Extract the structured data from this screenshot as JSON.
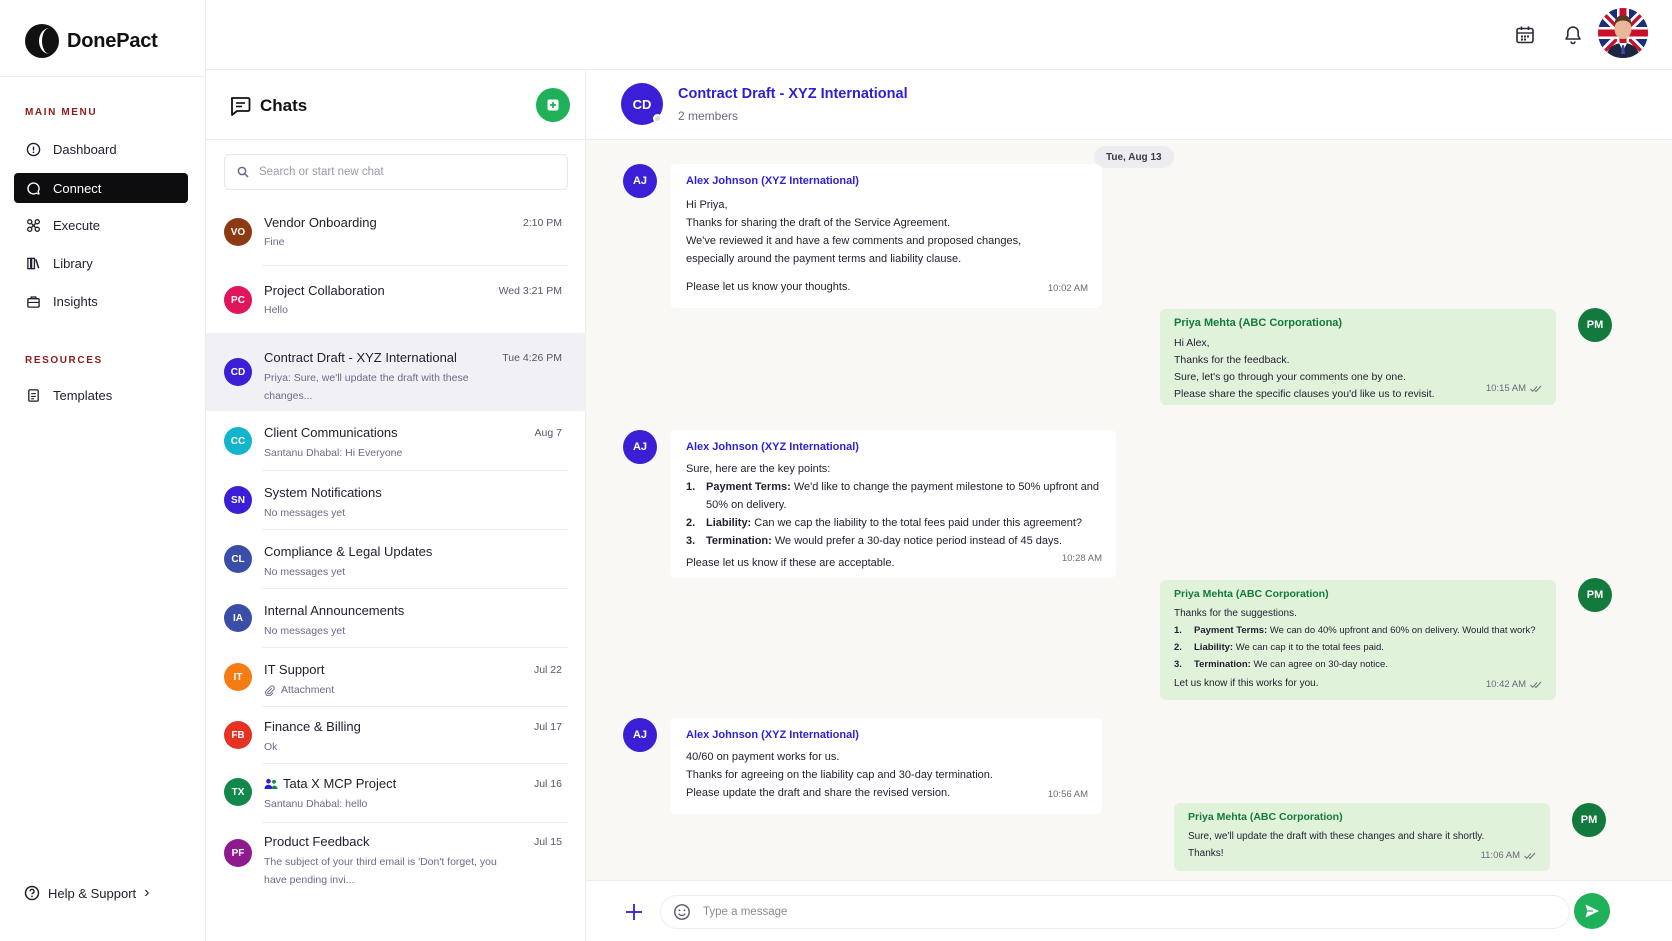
{
  "brand": {
    "name": "DonePact"
  },
  "sidebar": {
    "main_menu_title": "MAIN MENU",
    "resources_title": "RESOURCES",
    "items": [
      {
        "label": "Dashboard",
        "icon": "info-circle-icon"
      },
      {
        "label": "Connect",
        "icon": "chat-bubble-icon",
        "active": true
      },
      {
        "label": "Execute",
        "icon": "workflow-icon"
      },
      {
        "label": "Library",
        "icon": "books-icon"
      },
      {
        "label": "Insights",
        "icon": "briefcase-icon"
      }
    ],
    "resources": [
      {
        "label": "Templates",
        "icon": "document-icon"
      }
    ],
    "help_label": "Help & Support",
    "help_chevron": "›"
  },
  "chats": {
    "title": "Chats",
    "search_placeholder": "Search or start new chat",
    "list": [
      {
        "initials": "VO",
        "name": "Vendor Onboarding",
        "time": "2:10 PM",
        "preview": "Fine",
        "color": "#8b3a12"
      },
      {
        "initials": "PC",
        "name": "Project Collaboration",
        "time": "Wed 3:21 PM",
        "preview": "Hello",
        "color": "#e0155a"
      },
      {
        "initials": "CD",
        "name": "Contract Draft - XYZ International",
        "time": "Tue 4:26 PM",
        "preview": "Priya: Sure, we'll update the draft with these changes...",
        "color": "#3b1fd6"
      },
      {
        "initials": "CC",
        "name": "Client Communications",
        "time": "Aug 7",
        "preview": "Santanu Dhabal: Hi Everyone",
        "color": "#12b5cb"
      },
      {
        "initials": "SN",
        "name": "System Notifications",
        "time": "",
        "preview": "No messages yet",
        "color": "#3b1fd6"
      },
      {
        "initials": "CL",
        "name": "Compliance & Legal Updates",
        "time": "",
        "preview": "No messages yet",
        "color": "#3a4ea8"
      },
      {
        "initials": "IA",
        "name": "Internal Announcements",
        "time": "",
        "preview": "No messages yet",
        "color": "#3a4ea8"
      },
      {
        "initials": "IT",
        "name": "IT Support",
        "time": "Jul 22",
        "preview": "Attachment",
        "color": "#f57c12"
      },
      {
        "initials": "FB",
        "name": "Finance & Billing",
        "time": "Jul 17",
        "preview": "Ok",
        "color": "#e53222"
      },
      {
        "initials": "TX",
        "name": "Tata X MCP Project",
        "time": "Jul 16",
        "preview": "Santanu Dhabal: hello",
        "color": "#12884a"
      },
      {
        "initials": "PF",
        "name": "Product Feedback",
        "time": "Jul 15",
        "preview": "The subject of your third email is 'Don't forget, you have pending invi...",
        "color": "#8e1a8e"
      }
    ]
  },
  "conversation": {
    "initials": "CD",
    "title": "Contract Draft - XYZ International",
    "subtitle": "2 members",
    "date_pill": "Tue, Aug 13",
    "messages": {
      "m1": {
        "initials": "AJ",
        "sender": "Alex Johnson (XYZ International)",
        "lines": [
          "Hi Priya,",
          "Thanks for sharing the draft of the Service Agreement.",
          "We've reviewed it and have a few comments and proposed changes,",
          "especially around the payment terms and liability clause."
        ],
        "closing": "Please let us know your thoughts.",
        "time": "10:02 AM"
      },
      "m2": {
        "initials": "PM",
        "sender": "Priya Mehta (ABC Corporationa)",
        "lines": [
          "Hi Alex,",
          "Thanks for the feedback.",
          "Sure, let's go through your comments one by one.",
          "Please share the specific clauses you'd like us to revisit."
        ],
        "time": "10:15 AM"
      },
      "m3": {
        "initials": "AJ",
        "sender": "Alex Johnson (XYZ International)",
        "intro": "Sure, here are the key points:",
        "points": [
          {
            "num": "1.",
            "label": "Payment Terms:",
            "text": "We'd like to change the payment milestone to 50% upfront and 50% on delivery."
          },
          {
            "num": "2.",
            "label": "Liability:",
            "text": "Can we cap the liability to the total fees paid under this agreement?"
          },
          {
            "num": "3.",
            "label": "Termination:",
            "text": "We would prefer a 30-day notice period instead of 45 days."
          }
        ],
        "closing": "Please let us know if these are acceptable.",
        "time": "10:28 AM"
      },
      "m4": {
        "initials": "PM",
        "sender": "Priya Mehta (ABC Corporation)",
        "intro": "Thanks for the suggestions.",
        "points": [
          {
            "num": "1.",
            "label": "Payment Terms:",
            "text": "We can do 40% upfront and 60% on delivery. Would that work?"
          },
          {
            "num": "2.",
            "label": "Liability:",
            "text": "We can cap it to the total fees paid."
          },
          {
            "num": "3.",
            "label": "Termination:",
            "text": "We can agree on 30-day notice."
          }
        ],
        "closing": "Let us know if this works for you.",
        "time": "10:42 AM"
      },
      "m5": {
        "initials": "AJ",
        "sender": "Alex Johnson (XYZ International)",
        "lines": [
          "40/60 on payment works for us.",
          "Thanks for agreeing on the liability cap and 30-day termination.",
          "Please update the draft and share the revised version."
        ],
        "time": "10:56 AM"
      },
      "m6": {
        "initials": "PM",
        "sender": "Priya Mehta (ABC Corporation)",
        "lines": [
          "Sure, we'll update the draft with these changes and share it shortly.",
          "Thanks!"
        ],
        "time": "11:06 AM"
      }
    }
  },
  "composer": {
    "placeholder": "Type a message"
  },
  "colors": {
    "accent_green": "#1fb05a",
    "accent_blue": "#2d1fd6",
    "active_nav": "#0d0d10",
    "out_bubble": "#e1f2db"
  }
}
